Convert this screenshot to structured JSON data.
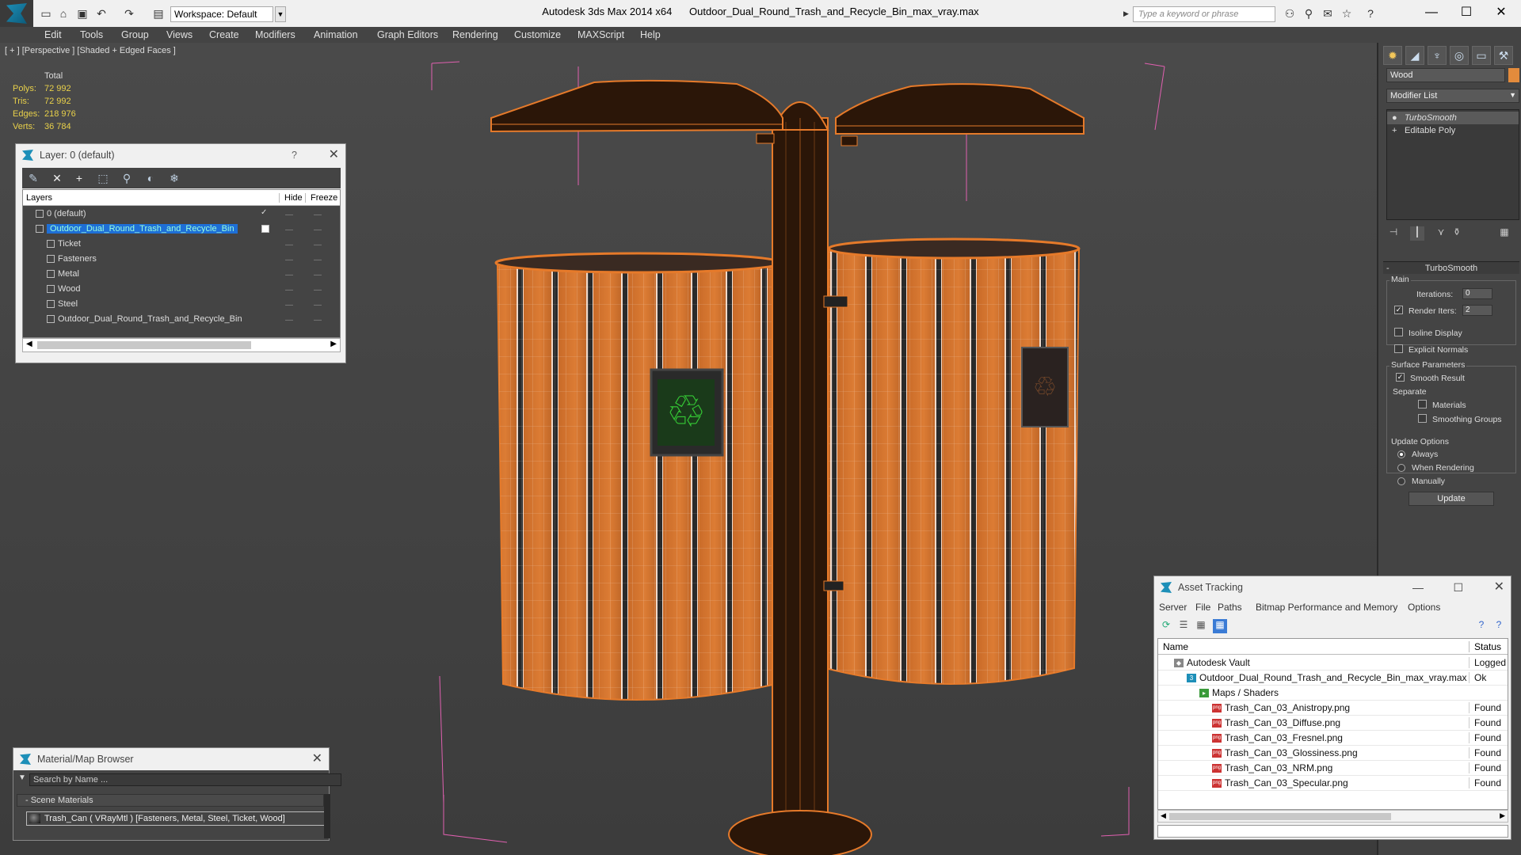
{
  "window": {
    "app_title": "Autodesk 3ds Max  2014 x64",
    "file_title": "Outdoor_Dual_Round_Trash_and_Recycle_Bin_max_vray.max",
    "workspace": "Workspace: Default",
    "search_placeholder": "Type a keyword or phrase"
  },
  "menu": [
    "Edit",
    "Tools",
    "Group",
    "Views",
    "Create",
    "Modifiers",
    "Animation",
    "Graph Editors",
    "Rendering",
    "Customize",
    "MAXScript",
    "Help"
  ],
  "viewport": {
    "label": "[ + ] [Perspective ] [Shaded + Edged Faces ]",
    "stats": {
      "header": "Total",
      "polys_label": "Polys:",
      "polys": "72 992",
      "tris_label": "Tris:",
      "tris": "72 992",
      "edges_label": "Edges:",
      "edges": "218 976",
      "verts_label": "Verts:",
      "verts": "36 784"
    }
  },
  "layer_panel": {
    "title": "Layer: 0 (default)",
    "help": "?",
    "col_layers": "Layers",
    "col_hide": "Hide",
    "col_freeze": "Freeze",
    "rows": [
      {
        "name": "0 (default)",
        "level": 0,
        "checked": true
      },
      {
        "name": "Outdoor_Dual_Round_Trash_and_Recycle_Bin",
        "level": 0,
        "selected": true
      },
      {
        "name": "Ticket",
        "level": 1
      },
      {
        "name": "Fasteners",
        "level": 1
      },
      {
        "name": "Metal",
        "level": 1
      },
      {
        "name": "Wood",
        "level": 1
      },
      {
        "name": "Steel",
        "level": 1
      },
      {
        "name": "Outdoor_Dual_Round_Trash_and_Recycle_Bin",
        "level": 1
      }
    ],
    "dash": "—"
  },
  "command_panel": {
    "object_name": "Wood",
    "object_color": "#e38b3c",
    "modifier_list": "Modifier List",
    "stack": [
      "TurboSmooth",
      "Editable Poly"
    ],
    "rollout_title": "TurboSmooth",
    "main_label": "Main",
    "iterations_label": "Iterations:",
    "iterations": "0",
    "render_iters_label": "Render Iters:",
    "render_iters": "2",
    "isoline": "Isoline Display",
    "explicit_normals": "Explicit Normals",
    "surface_params": "Surface Parameters",
    "smooth_result": "Smooth Result",
    "separate": "Separate",
    "materials": "Materials",
    "smoothing_groups": "Smoothing Groups",
    "update_options": "Update Options",
    "always": "Always",
    "when_rendering": "When Rendering",
    "manually": "Manually",
    "update_btn": "Update"
  },
  "asset_panel": {
    "title": "Asset Tracking",
    "menu": [
      "Server",
      "File",
      "Paths",
      "Bitmap Performance and Memory",
      "Options"
    ],
    "col_name": "Name",
    "col_status": "Status",
    "rows": [
      {
        "name": "Autodesk Vault",
        "status": "Logged Out",
        "indent": 0,
        "icon": "vault-icon"
      },
      {
        "name": "Outdoor_Dual_Round_Trash_and_Recycle_Bin_max_vray.max",
        "status": "Ok",
        "indent": 1,
        "icon": "max-file-icon"
      },
      {
        "name": "Maps / Shaders",
        "status": "",
        "indent": 2,
        "icon": "folder-icon"
      },
      {
        "name": "Trash_Can_03_Anistropy.png",
        "status": "Found",
        "indent": 3,
        "icon": "png-icon"
      },
      {
        "name": "Trash_Can_03_Diffuse.png",
        "status": "Found",
        "indent": 3,
        "icon": "png-icon"
      },
      {
        "name": "Trash_Can_03_Fresnel.png",
        "status": "Found",
        "indent": 3,
        "icon": "png-icon"
      },
      {
        "name": "Trash_Can_03_Glossiness.png",
        "status": "Found",
        "indent": 3,
        "icon": "png-icon"
      },
      {
        "name": "Trash_Can_03_NRM.png",
        "status": "Found",
        "indent": 3,
        "icon": "png-icon"
      },
      {
        "name": "Trash_Can_03_Specular.png",
        "status": "Found",
        "indent": 3,
        "icon": "png-icon"
      }
    ]
  },
  "material_panel": {
    "title": "Material/Map Browser",
    "search_placeholder": "Search by Name ...",
    "group": "- Scene Materials",
    "item": "Trash_Can  ( VRayMtl )  [Fasteners, Metal, Steel, Ticket, Wood]"
  }
}
